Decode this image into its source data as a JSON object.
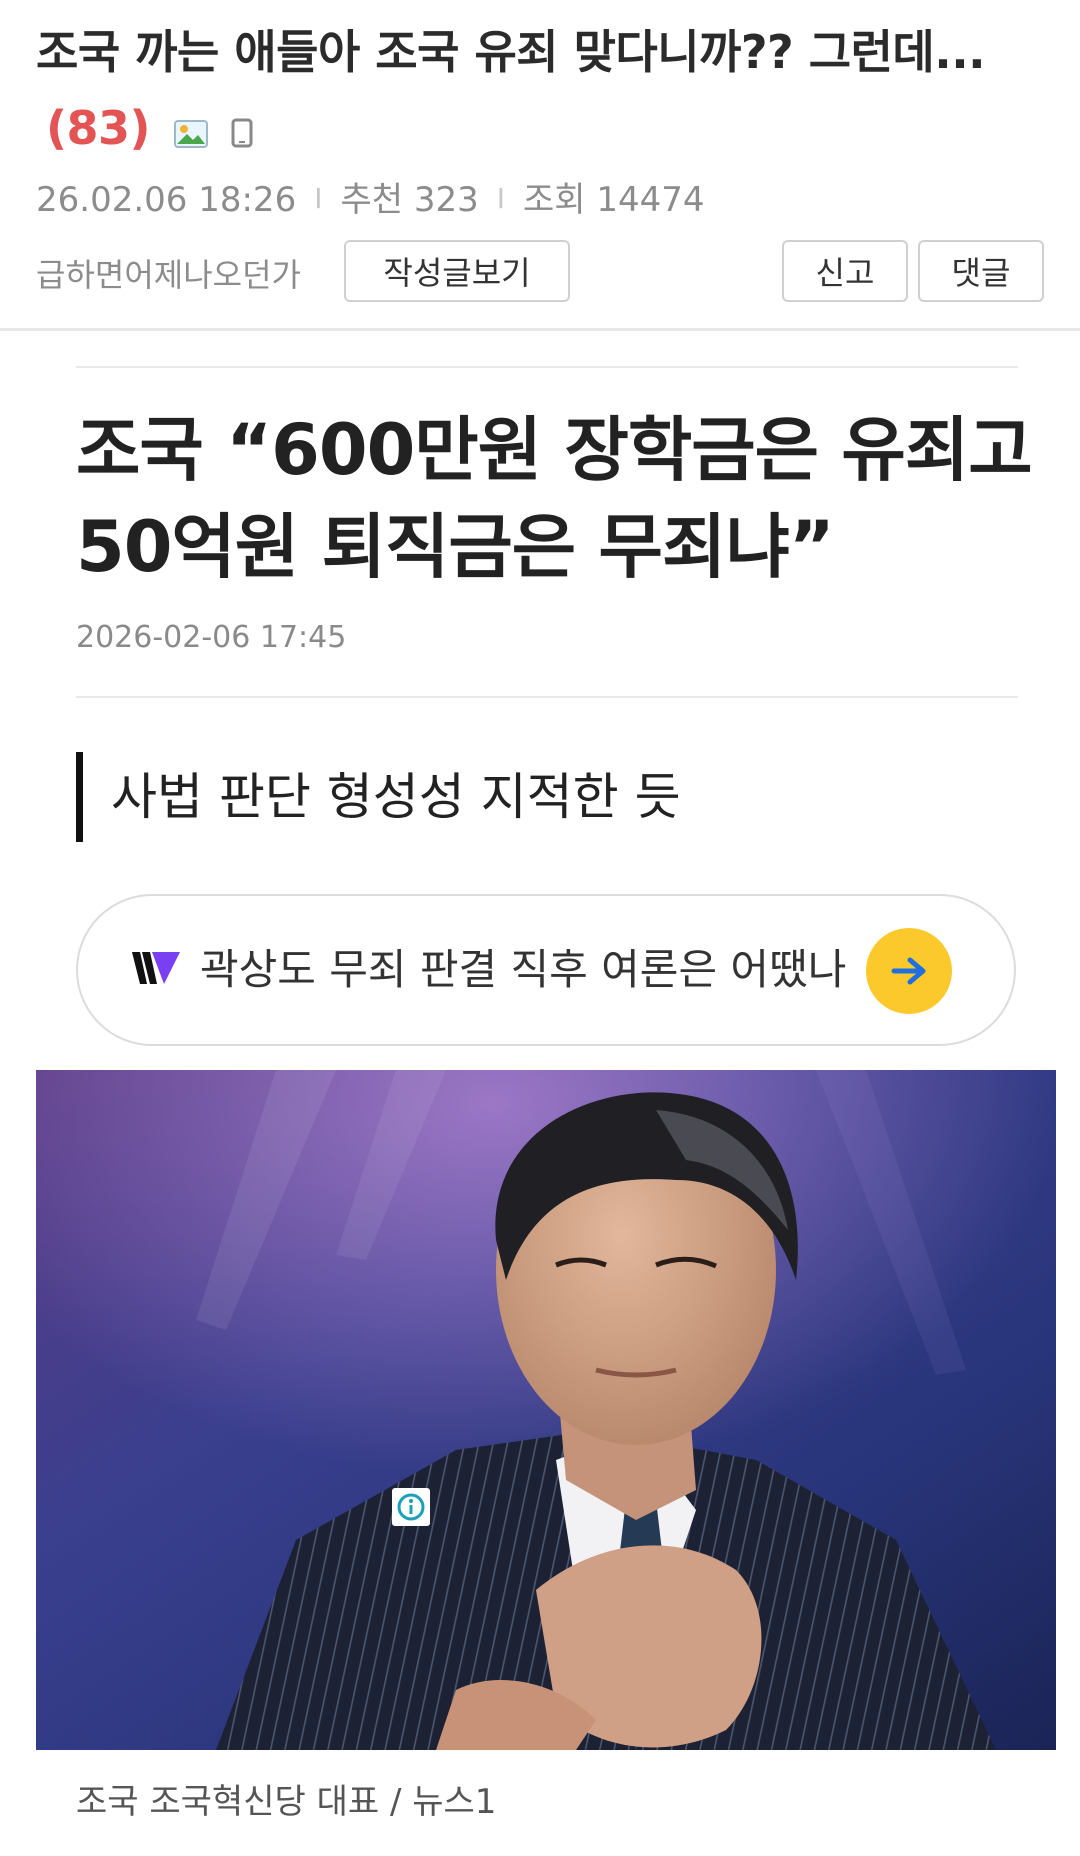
{
  "post": {
    "title": "조국 까는 애들아 조국 유죄 맞다니까?? 그런데...",
    "comment_count": "(83)",
    "date": "26.02.06  18:26",
    "recommend": "추천 323",
    "views": "조회 14474",
    "author": "급하면어제나오던가",
    "icons": [
      "image-icon",
      "mobile-icon"
    ]
  },
  "buttons": {
    "author_posts": "작성글보기",
    "report": "신고",
    "reply": "댓글"
  },
  "article": {
    "headline": "조국 “600만원 장학금은 유죄고 50억원 퇴직금은 무죄냐”",
    "date": "2026-02-06 17:45",
    "subhead": "사법 판단 형성성 지적한 듯",
    "ask_text": "곽상도 무죄 판결 직후 여론은 어땠나",
    "photo_caption": "조국 조국혁신당 대표 / 뉴스1"
  },
  "colors": {
    "comment_count": "#e35454",
    "ask_button": "#fbc92c",
    "ask_arrow": "#1f6fe0",
    "logo_purple": "#7a3ff2"
  }
}
